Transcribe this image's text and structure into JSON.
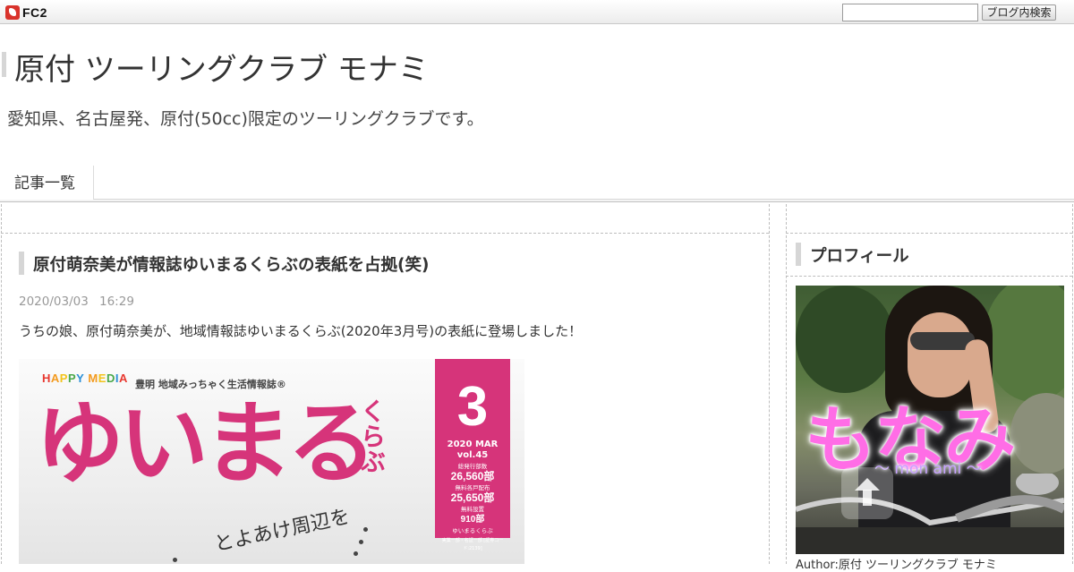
{
  "topbar": {
    "logo_text": "FC2",
    "search_placeholder": "",
    "search_button": "ブログ内検索"
  },
  "header": {
    "title": "原付 ツーリングクラブ モナミ",
    "description": "愛知県、名古屋発、原付(50cc)限定のツーリングクラブです。"
  },
  "nav": {
    "items": [
      {
        "label": "記事一覧"
      }
    ]
  },
  "article": {
    "title": "原付萌奈美が情報誌ゆいまるくらぶの表紙を占拠(笑)",
    "date": "2020/03/03",
    "time": "16:29",
    "body": "うちの娘、原付萌奈美が、地域情報誌ゆいまるくらぶ(2020年3月号)の表紙に登場しました！",
    "cover": {
      "brand_letters": [
        "H",
        "A",
        "P",
        "P",
        "Y",
        " ",
        "M",
        "E",
        "D",
        "I",
        "A"
      ],
      "brand_colors": [
        "#e8382f",
        "#f39a1e",
        "#f2c31b",
        "#4aa84a",
        "#2b8fd6"
      ],
      "subtitle": "豊明 地域みっちゃく生活情報誌®",
      "logo": "ゆいまる",
      "logo_kana": "くらぶ",
      "issue_number": "3",
      "issue_date": "2020 MAR",
      "volume": "vol.45",
      "circulation_label": "総発行部数",
      "circulation": "26,560部",
      "delivered_label": "無料各戸配布",
      "delivered": "25,650部",
      "placed_label": "無料設置",
      "placed": "910部",
      "publisher_note": "ゆいまるくらぶ",
      "publisher_note2": "実業一部・名証一部 [証券コード:2139]",
      "tagline": "とよあけ周辺を"
    }
  },
  "sidebar": {
    "profile_title": "プロフィール",
    "profile_image_label": "もなみ",
    "profile_image_sub": "〜 mon ami 〜",
    "author": "Author:原付 ツーリングクラブ モナミ"
  }
}
